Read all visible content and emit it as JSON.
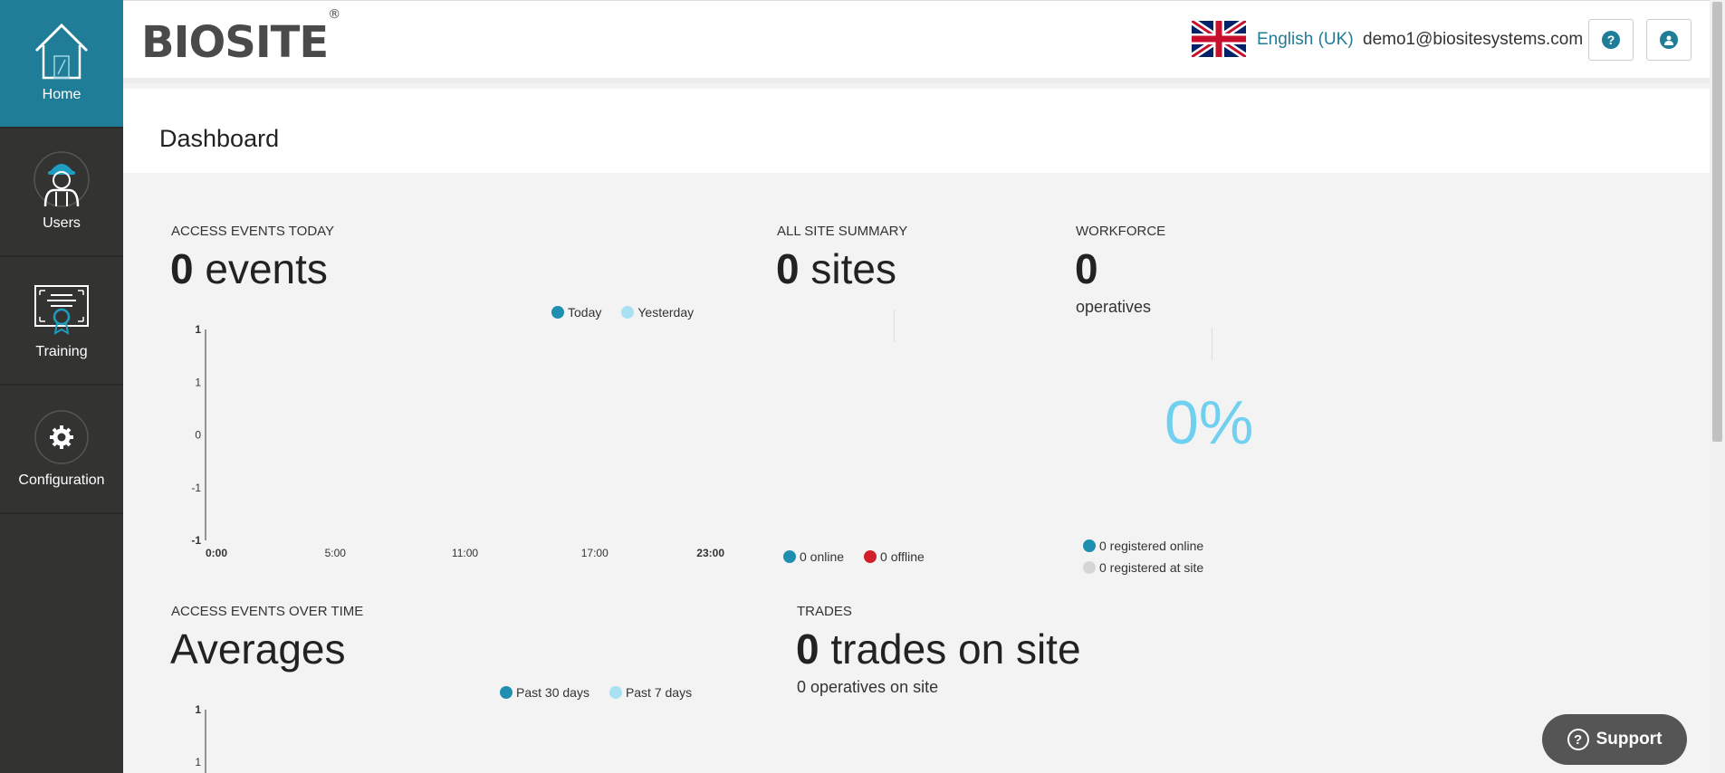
{
  "sidebar": {
    "items": [
      {
        "label": "Home",
        "icon": "home-icon"
      },
      {
        "label": "Users",
        "icon": "worker-icon"
      },
      {
        "label": "Training",
        "icon": "certificate-icon"
      },
      {
        "label": "Configuration",
        "icon": "gear-icon"
      }
    ]
  },
  "header": {
    "logo": "BIOSITE",
    "logo_mark": "®",
    "language": "English (UK)",
    "email": "demo1@biositesystems.com",
    "help_icon": "help-icon",
    "account_icon": "user-icon"
  },
  "page": {
    "title": "Dashboard"
  },
  "access_today": {
    "title": "ACCESS EVENTS TODAY",
    "count": "0",
    "unit": "events",
    "legend": [
      "Today",
      "Yesterday"
    ]
  },
  "site_summary": {
    "title": "ALL SITE SUMMARY",
    "count": "0",
    "unit": "sites",
    "online": "0 online",
    "offline": "0 offline"
  },
  "workforce": {
    "title": "WORKFORCE",
    "count": "0",
    "unit": "operatives",
    "percent": "0%",
    "registered_online": "0 registered online",
    "registered_at_site": "0 registered at site"
  },
  "access_over_time": {
    "title": "ACCESS EVENTS OVER TIME",
    "heading": "Averages",
    "legend": [
      "Past 30 days",
      "Past 7 days"
    ]
  },
  "trades": {
    "title": "TRADES",
    "count": "0",
    "unit": "trades on site",
    "sub": "0 operatives on site"
  },
  "support": {
    "label": "Support"
  },
  "colors": {
    "accent": "#1f7d97",
    "light_accent": "#a9e1f3",
    "offline": "#d0202a",
    "grey": "#d6d6d6"
  },
  "chart_data": [
    {
      "type": "line",
      "title": "",
      "categories": [
        "0:00",
        "5:00",
        "11:00",
        "17:00",
        "23:00"
      ],
      "yticks": [
        "1",
        "1",
        "0",
        "-1",
        "-1"
      ],
      "series": [
        {
          "name": "Today",
          "values": []
        },
        {
          "name": "Yesterday",
          "values": []
        }
      ]
    },
    {
      "type": "line",
      "title": "",
      "yticks": [
        "1",
        "1"
      ],
      "series": [
        {
          "name": "Past 30 days",
          "values": []
        },
        {
          "name": "Past 7 days",
          "values": []
        }
      ]
    }
  ]
}
